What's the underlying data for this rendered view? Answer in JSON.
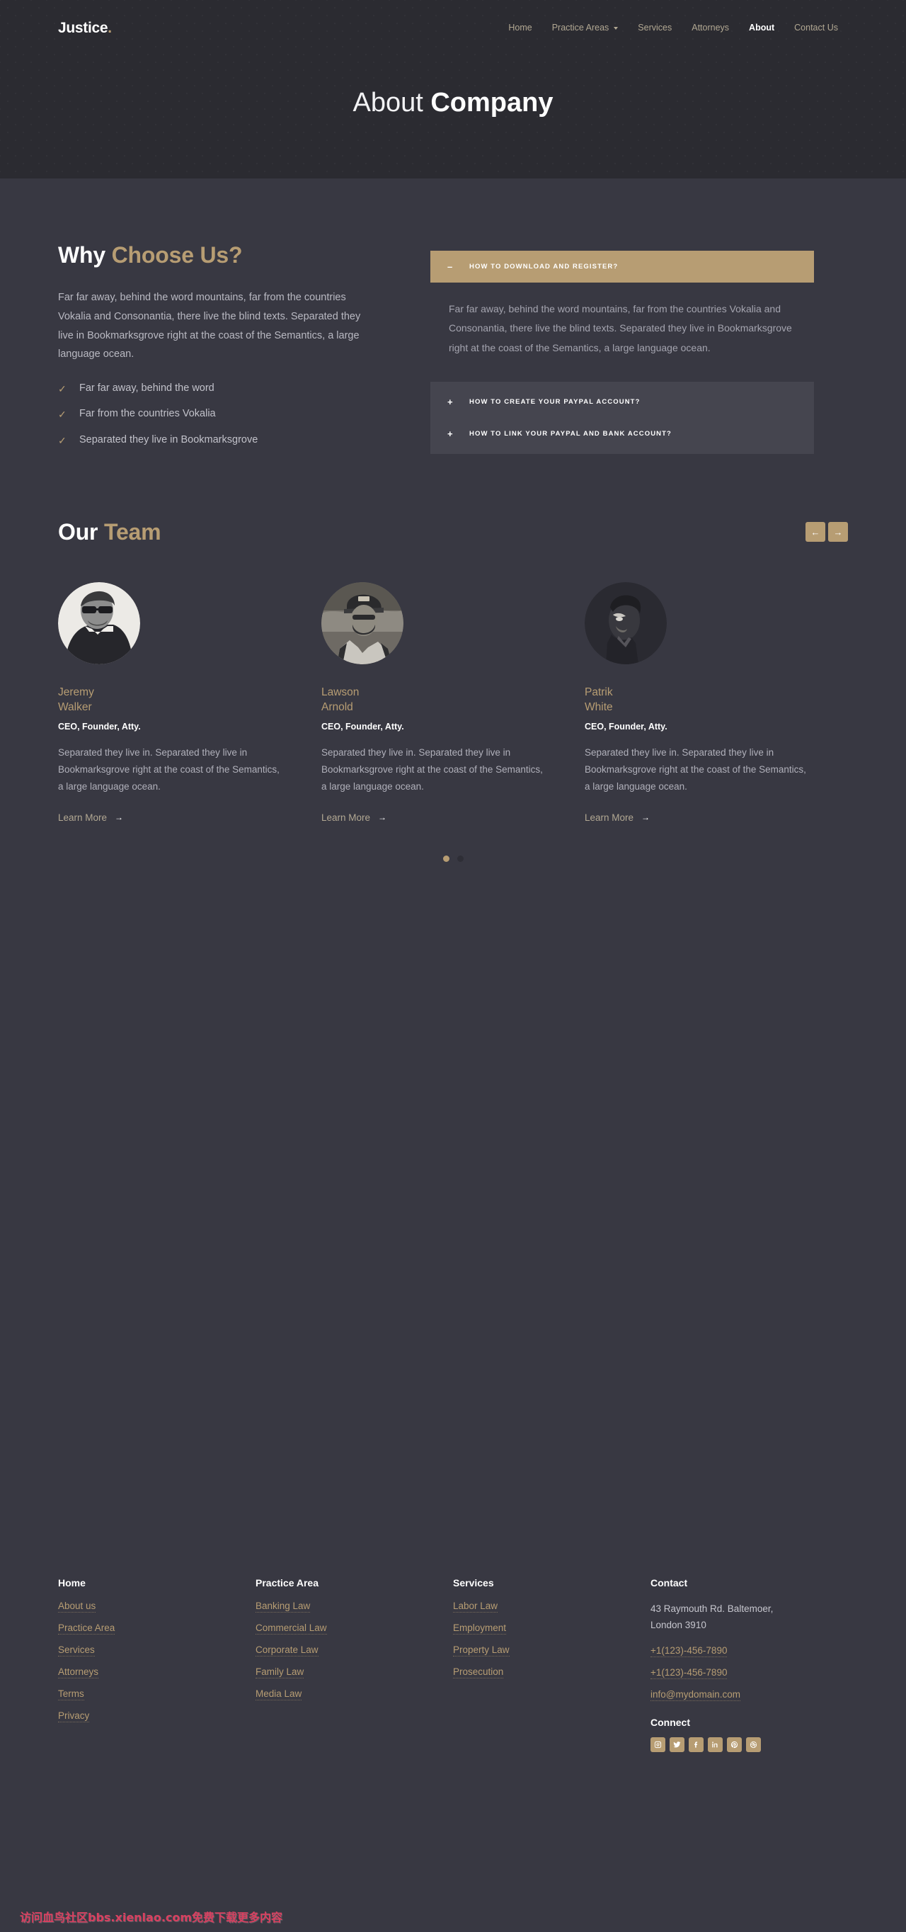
{
  "brand": {
    "name": "Justice",
    "dot": ".",
    "accent_color": "#b79d73"
  },
  "nav": {
    "items": [
      {
        "label": "Home",
        "active": false,
        "has_caret": false
      },
      {
        "label": "Practice Areas",
        "active": false,
        "has_caret": true
      },
      {
        "label": "Services",
        "active": false,
        "has_caret": false
      },
      {
        "label": "Attorneys",
        "active": false,
        "has_caret": false
      },
      {
        "label": "About",
        "active": true,
        "has_caret": false
      },
      {
        "label": "Contact Us",
        "active": false,
        "has_caret": false
      }
    ]
  },
  "hero": {
    "title_light": "About ",
    "title_bold": "Company"
  },
  "why": {
    "title_white": "Why ",
    "title_gold": "Choose Us?",
    "paragraph": "Far far away, behind the word mountains, far from the countries Vokalia and Consonantia, there live the blind texts. Separated they live in Bookmarksgrove right at the coast of the Semantics, a large language ocean.",
    "checks": [
      "Far far away, behind the word",
      "Far from the countries Vokalia",
      "Separated they live in Bookmarksgrove"
    ],
    "check_icon": "check-icon"
  },
  "accordion": {
    "open": {
      "sign": "–",
      "title": "HOW TO DOWNLOAD AND REGISTER?",
      "body": "Far far away, behind the word mountains, far from the countries Vokalia and Consonantia, there live the blind texts. Separated they live in Bookmarksgrove right at the coast of the Semantics, a large language ocean."
    },
    "closed": [
      {
        "sign": "+",
        "title": "HOW TO CREATE YOUR PAYPAL ACCOUNT?"
      },
      {
        "sign": "+",
        "title": "HOW TO LINK YOUR PAYPAL AND BANK ACCOUNT?"
      }
    ]
  },
  "team": {
    "title_white": "Our ",
    "title_gold": "Team",
    "prev_icon": "←",
    "next_icon": "→",
    "members": [
      {
        "first": "Jeremy",
        "last": "Walker",
        "role": "CEO, Founder, Atty.",
        "desc": "Separated they live in. Separated they live in Bookmarksgrove right at the coast of the Semantics, a large language ocean.",
        "link": "Learn More",
        "link_arrow": "→",
        "avatar": "avatar-jeremy-walker"
      },
      {
        "first": "Lawson",
        "last": "Arnold",
        "role": "CEO, Founder, Atty.",
        "desc": "Separated they live in. Separated they live in Bookmarksgrove right at the coast of the Semantics, a large language ocean.",
        "link": "Learn More",
        "link_arrow": "→",
        "avatar": "avatar-lawson-arnold"
      },
      {
        "first": "Patrik",
        "last": "White",
        "role": "CEO, Founder, Atty.",
        "desc": "Separated they live in. Separated they live in Bookmarksgrove right at the coast of the Semantics, a large language ocean.",
        "link": "Learn More",
        "link_arrow": "→",
        "avatar": "avatar-patrik-white"
      }
    ],
    "dots": [
      {
        "active": true
      },
      {
        "active": false
      }
    ]
  },
  "footer": {
    "columns": [
      {
        "title": "Home",
        "links": [
          "About us",
          "Practice Area",
          "Services",
          "Attorneys",
          "Terms",
          "Privacy"
        ]
      },
      {
        "title": "Practice Area",
        "links": [
          "Banking Law",
          "Commercial Law",
          "Corporate Law",
          "Family Law",
          "Media Law"
        ]
      },
      {
        "title": "Services",
        "links": [
          "Labor Law",
          "Employment",
          "Property Law",
          "Prosecution"
        ]
      }
    ],
    "contact": {
      "title": "Contact",
      "address_line1": "43 Raymouth Rd. Baltemoer,",
      "address_line2": "London 3910",
      "phone1": "+1(123)-456-7890",
      "phone2": "+1(123)-456-7890",
      "email": "info@mydomain.com",
      "connect_title": "Connect",
      "socials": [
        {
          "name": "instagram-icon"
        },
        {
          "name": "twitter-icon"
        },
        {
          "name": "facebook-icon"
        },
        {
          "name": "linkedin-icon"
        },
        {
          "name": "pinterest-icon"
        },
        {
          "name": "dribbble-icon"
        }
      ]
    }
  },
  "watermark": {
    "text": "访问血鸟社区bbs.xienlao.com免费下载更多内容"
  }
}
